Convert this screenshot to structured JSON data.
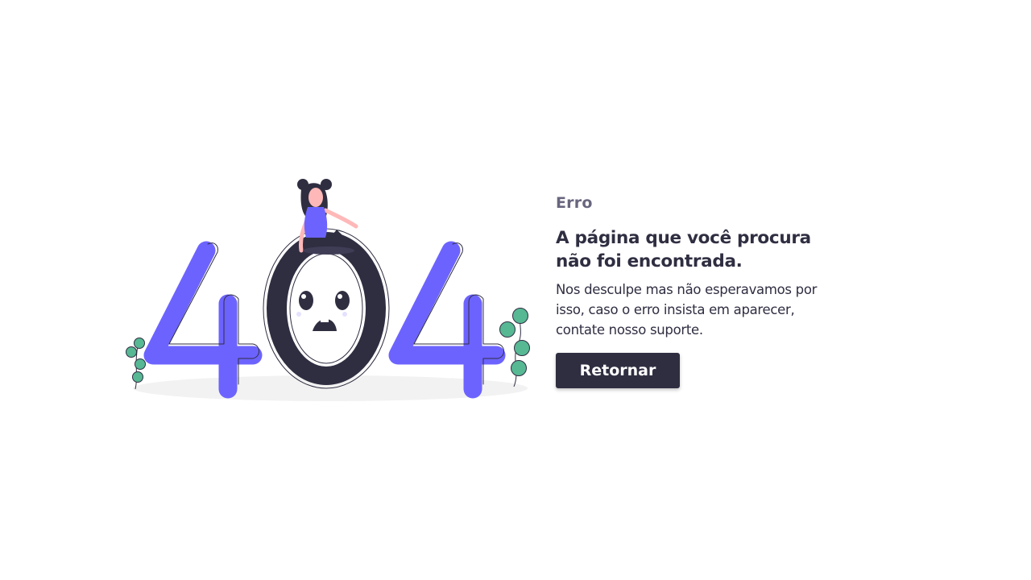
{
  "error": {
    "eyebrow": "Erro",
    "title": "A página que você procura não foi encontrada.",
    "description": "Nos desculpe mas não esperavamos por isso, caso o erro insista em aparecer, contate nosso suporte.",
    "button_label": "Retornar"
  },
  "illustration": {
    "digits": [
      "4",
      "0",
      "4"
    ],
    "icons": [
      "woman-figure-icon",
      "plant-icon"
    ]
  },
  "colors": {
    "accent": "#6c63ff",
    "dark": "#2f2e41",
    "muted": "#68667e",
    "plant": "#57b894",
    "skin": "#ffb8b8",
    "shadow": "#f2f2f2"
  }
}
